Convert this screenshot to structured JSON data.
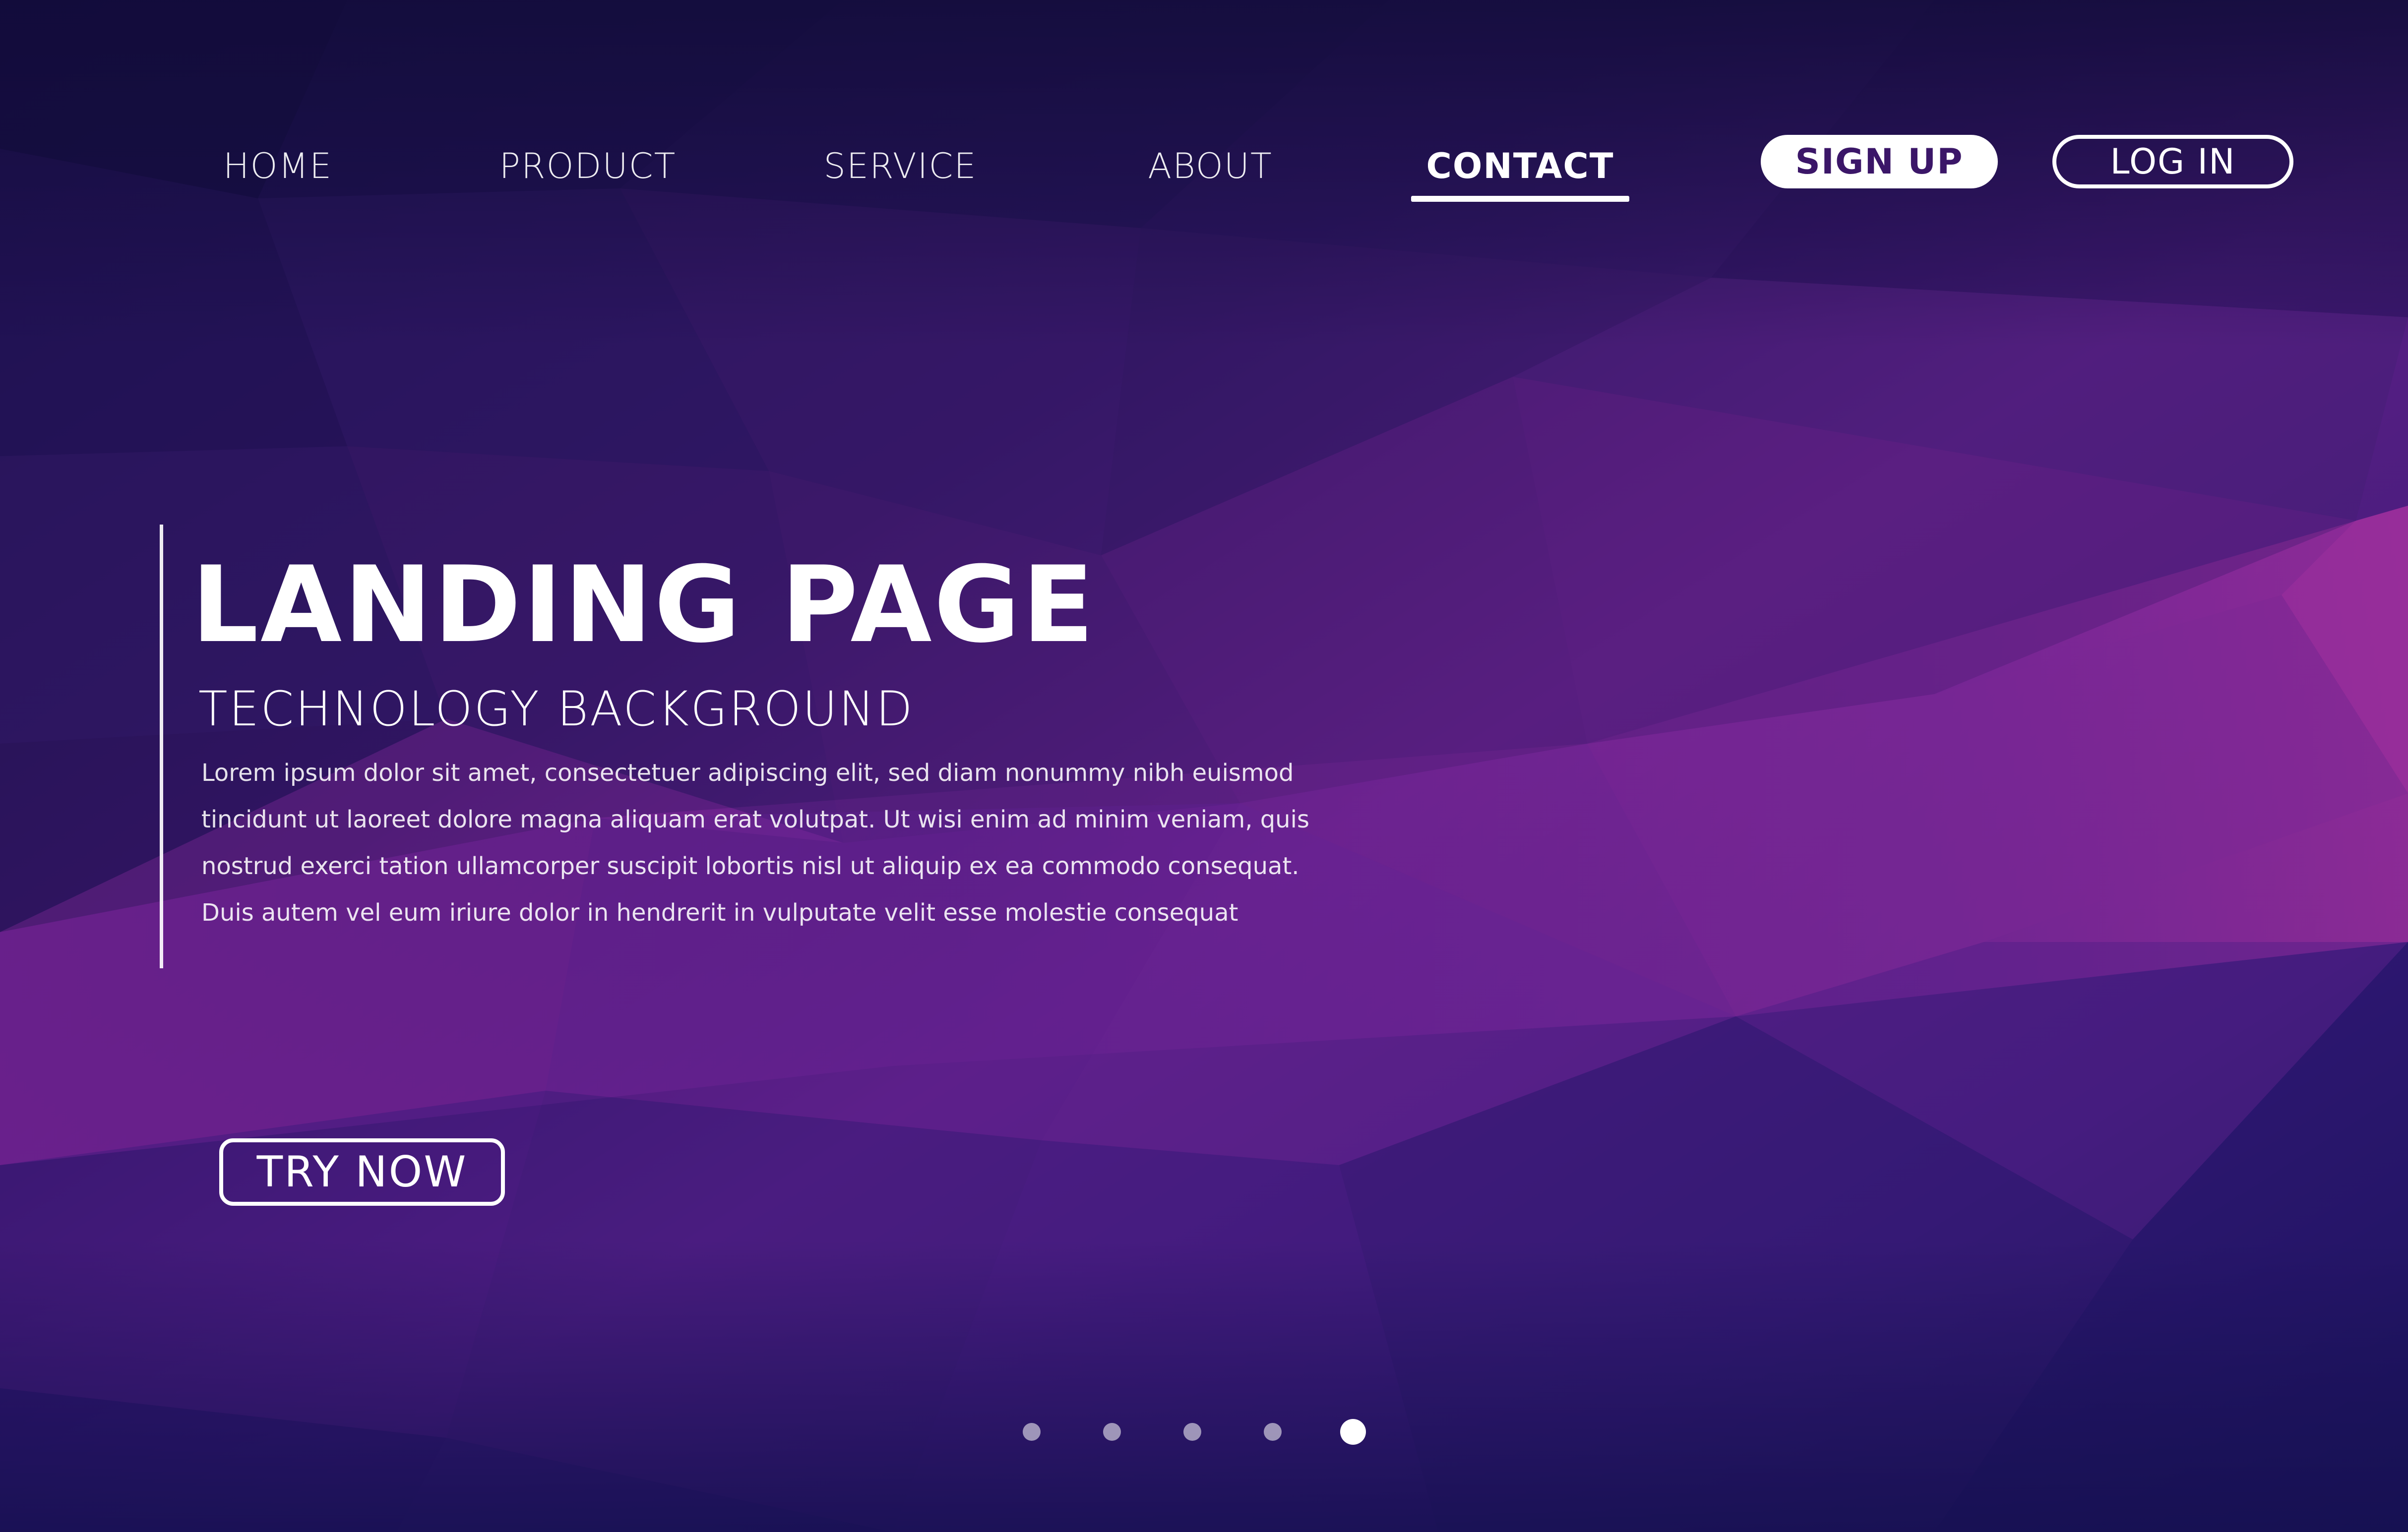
{
  "nav": {
    "items": [
      {
        "label": "HOME",
        "active": false
      },
      {
        "label": "PRODUCT",
        "active": false
      },
      {
        "label": "SERVICE",
        "active": false
      },
      {
        "label": "ABOUT",
        "active": false
      },
      {
        "label": "CONTACT",
        "active": true
      }
    ],
    "signup_label": "SIGN UP",
    "login_label": "LOG IN"
  },
  "hero": {
    "title": "LANDING PAGE",
    "subtitle": "TECHNOLOGY BACKGROUND",
    "paragraph_lines": [
      "Lorem ipsum dolor sit amet, consectetuer adipiscing elit, sed diam nonummy nibh euismod",
      "tincidunt ut laoreet dolore magna aliquam erat volutpat. Ut wisi enim ad minim veniam, quis",
      "nostrud exerci tation ullamcorper suscipit lobortis nisl ut aliquip ex ea commodo consequat.",
      "Duis autem vel eum iriure dolor in hendrerit in vulputate velit esse molestie consequat"
    ],
    "cta_label": "TRY NOW"
  },
  "pagination": {
    "count": 5,
    "active_index": 4
  },
  "colors": {
    "bg_dark": "#1c1150",
    "bg_mid": "#3d1a6e",
    "bg_magenta": "#8a2a9a",
    "bg_violet": "#5a2296",
    "text": "#ffffff",
    "signup_text": "#3b1668"
  }
}
